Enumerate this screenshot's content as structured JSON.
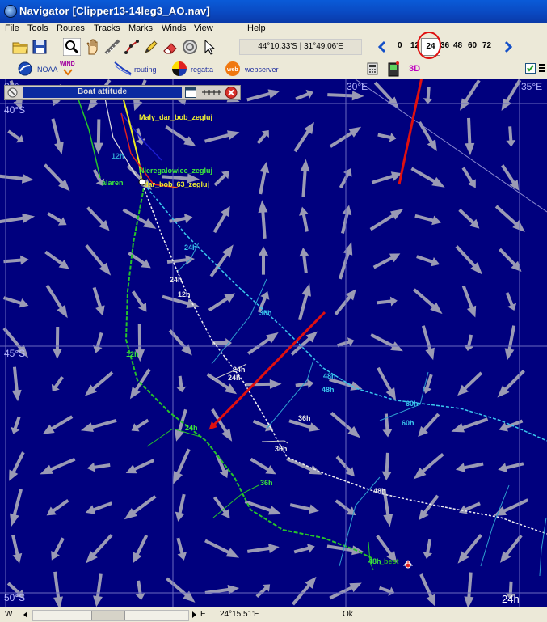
{
  "window": {
    "title": "Navigator [Clipper13-14leg3_AO.nav]"
  },
  "menu": [
    "File",
    "Tools",
    "Routes",
    "Tracks",
    "Marks",
    "Winds",
    "View",
    "Help"
  ],
  "toolbar": {
    "cursor_position": "44°10.33'S | 31°49.06'E",
    "forecast_hours": [
      "0",
      "12",
      "24",
      "36",
      "48",
      "60",
      "72"
    ],
    "selected_hour": "24"
  },
  "toolbar2": {
    "noaa": "NOAA",
    "wind": "WIND",
    "routing": "routing",
    "regatta": "regatta",
    "webserver": "webserver",
    "mode_3d": "3D"
  },
  "panel": {
    "title": "Boat attitude"
  },
  "map": {
    "lat_labels": [
      "40°S",
      "45°S",
      "50°S"
    ],
    "lon_labels": [
      "30°E",
      "35°E"
    ],
    "partial_lon_label": "25°",
    "boats": [
      "Maly_dar_bob_zegluj",
      "Nieregalowiec_zegluj",
      "dar_bob_63_zegluj",
      "alaren",
      "12h"
    ],
    "time_label": "24h",
    "best_label": "_best",
    "route_labels": {
      "green": [
        "12h",
        "24h",
        "36h",
        "48h"
      ],
      "white": [
        "24h",
        "12h",
        "24h",
        "24h",
        "36h",
        "36h",
        "48h"
      ],
      "cyan": [
        "24h",
        "36h",
        "48h",
        "48h",
        "60h",
        "60h"
      ]
    }
  },
  "status": {
    "w": "W",
    "longitude": "24°15.51'E",
    "state": "Ok",
    "e": "E"
  },
  "colors": {
    "sea": "#00007e",
    "title_blue": "#0a48c0",
    "annotation_red": "#e01010"
  }
}
